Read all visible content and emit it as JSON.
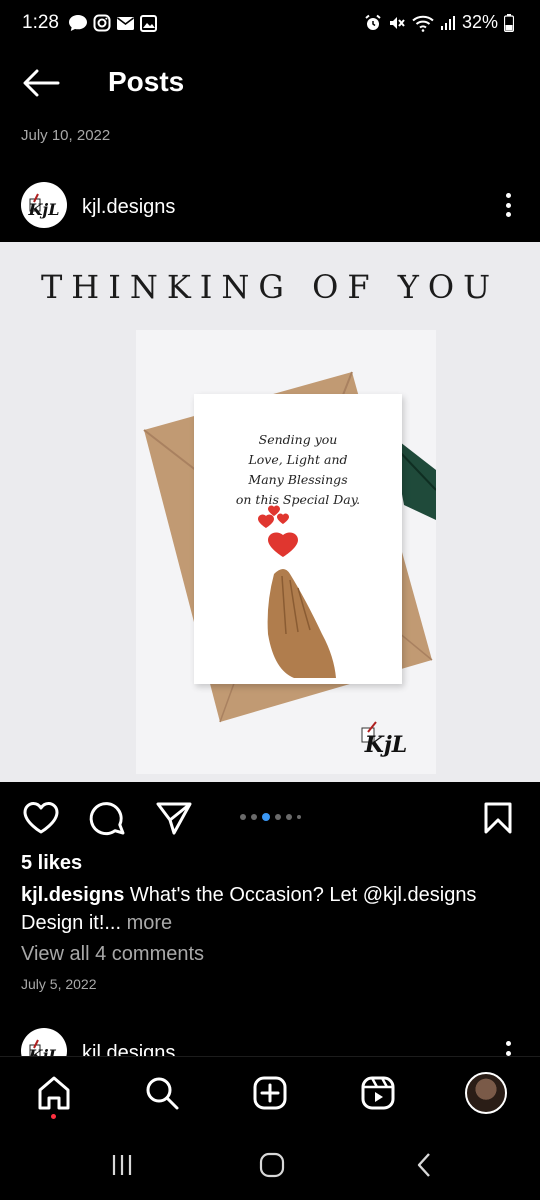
{
  "status_bar": {
    "time": "1:28",
    "battery": "32%",
    "left_icons": [
      "chat-bubble-icon",
      "instagram-icon",
      "mail-icon",
      "gallery-icon"
    ],
    "right_icons": [
      "alarm-icon",
      "mute-icon",
      "wifi-icon",
      "signal-icon",
      "battery-icon"
    ]
  },
  "header": {
    "title": "Posts",
    "back_icon": "arrow-left-icon"
  },
  "post": {
    "date_top": "July 10, 2022",
    "author": "kjl.designs",
    "image": {
      "title": "THINKING OF YOU",
      "card_lines": [
        "Sending you",
        "Love, Light and",
        "Many Blessings",
        "on this Special Day."
      ],
      "logo_text": "KjL"
    },
    "carousel": {
      "count": 6,
      "active_index": 2
    },
    "likes": "5 likes",
    "caption_user": "kjl.designs",
    "caption_text": " What's the Occasion? Let @kjl.designs Design it!...",
    "caption_more": " more",
    "view_comments": "View all 4 comments",
    "date_bottom": "July 5, 2022"
  },
  "next_post": {
    "author": "kjl.designs"
  },
  "bottom_nav": {
    "items": [
      "home-icon",
      "search-icon",
      "create-icon",
      "reels-icon",
      "profile-avatar"
    ]
  },
  "colors": {
    "background": "#000000",
    "secondary_text": "#a8a8a8",
    "carousel_active": "#3a97f5",
    "heart_red": "#e0362f",
    "notification_dot": "#ff3040"
  }
}
